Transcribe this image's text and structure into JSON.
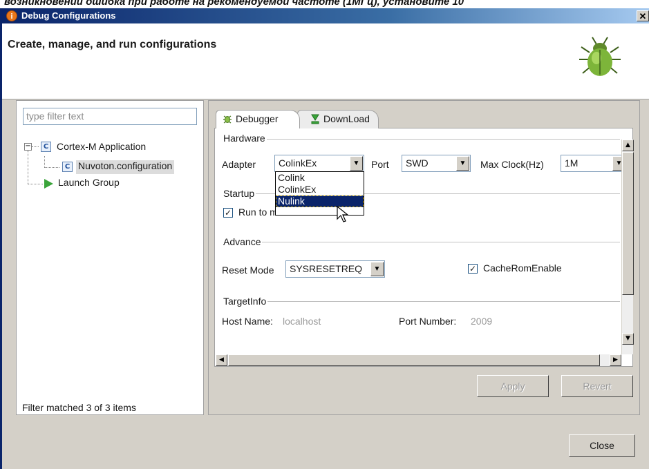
{
  "caption": "возникновении ошибка при работе на рекомендуемой частоте (1MГц), установите 10",
  "window": {
    "title": "Debug Configurations",
    "close_glyph": "✕"
  },
  "header": {
    "title": "Create, manage, and run configurations",
    "icon": "bug-icon"
  },
  "left_pane": {
    "filter_placeholder": "type filter text",
    "tree": [
      {
        "label": "Cortex-M Application",
        "toggle": "−",
        "icon": "C"
      },
      {
        "label": "Nuvoton.configuration",
        "icon": "C",
        "selected": true
      },
      {
        "label": "Launch Group",
        "icon": "launch-icon"
      }
    ],
    "status": "Filter matched 3 of 3 items"
  },
  "tabs": [
    {
      "label": "Debugger",
      "active": true
    },
    {
      "label": "DownLoad",
      "active": false
    }
  ],
  "hardware": {
    "group_title": "Hardware",
    "adapter_label": "Adapter",
    "adapter_value": "ColinkEx",
    "port_label": "Port",
    "port_value": "SWD",
    "max_clock_label": "Max Clock(Hz)",
    "max_clock_value": "1M",
    "adapter_options": [
      "Colink",
      "ColinkEx",
      "Nulink"
    ],
    "adapter_highlighted": "Nulink"
  },
  "startup": {
    "group_title": "Startup",
    "run_to_main_label": "Run to main",
    "run_to_main_checked": true
  },
  "advance": {
    "group_title": "Advance",
    "reset_mode_label": "Reset Mode",
    "reset_mode_value": "SYSRESETREQ",
    "cache_rom_label": "CacheRomEnable",
    "cache_rom_checked": true
  },
  "target_info": {
    "group_title": "TargetInfo",
    "host_name_label": "Host Name:",
    "host_name_value": "localhost",
    "port_number_label": "Port Number:",
    "port_number_value": "2009"
  },
  "buttons": {
    "apply": "Apply",
    "revert": "Revert",
    "close": "Close"
  },
  "colors": {
    "titlebar": "#0a246a",
    "selection": "#0a246a",
    "window_bg": "#d4d0c8"
  }
}
